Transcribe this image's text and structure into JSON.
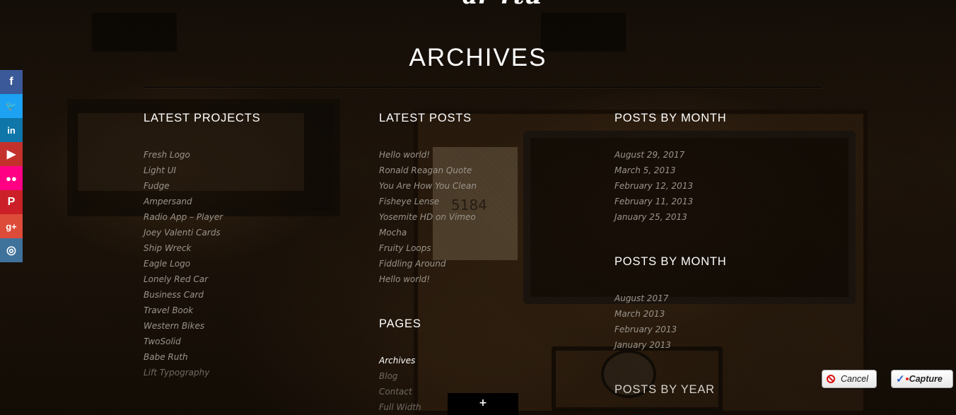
{
  "header": {
    "top_script": "ar-rtu",
    "page_title": "ARCHIVES"
  },
  "background": {
    "card_number": "5184"
  },
  "social": [
    {
      "icon": "facebook-icon",
      "glyph": "f",
      "color": "#3b5998"
    },
    {
      "icon": "twitter-icon",
      "glyph": "🐦",
      "color": "#1da1f2"
    },
    {
      "icon": "linkedin-icon",
      "glyph": "in",
      "color": "#0e76a8"
    },
    {
      "icon": "youtube-icon",
      "glyph": "▶",
      "color": "#c4302b"
    },
    {
      "icon": "flickr-icon",
      "glyph": "●●",
      "color": "#ff0084"
    },
    {
      "icon": "pinterest-icon",
      "glyph": "P",
      "color": "#cb2027"
    },
    {
      "icon": "google-plus-icon",
      "glyph": "g+",
      "color": "#dd4b39"
    },
    {
      "icon": "instagram-icon",
      "glyph": "◎",
      "color": "#3f729b"
    }
  ],
  "latest_projects": {
    "heading": "LATEST PROJECTS",
    "items": [
      "Fresh Logo",
      "Light UI",
      "Fudge",
      "Ampersand",
      "Radio App – Player",
      "Joey Valenti Cards",
      "Ship Wreck",
      "Eagle Logo",
      "Lonely Red Car",
      "Business Card",
      "Travel Book",
      "Western Bikes",
      "TwoSolid",
      "Babe Ruth",
      "Lift Typography"
    ]
  },
  "latest_posts": {
    "heading": "LATEST POSTS",
    "items": [
      "Hello world!",
      "Ronald Reagan Quote",
      "You Are How You Clean",
      "Fisheye Lense",
      "Yosemite HD on Vimeo",
      "Mocha",
      "Fruity Loops",
      "Fiddling Around",
      "Hello world!"
    ]
  },
  "pages": {
    "heading": "PAGES",
    "items": [
      "Archives",
      "Blog",
      "Contact",
      "Full Width"
    ]
  },
  "posts_by_month_daily": {
    "heading": "POSTS BY MONTH",
    "items": [
      "August 29, 2017",
      "March 5, 2013",
      "February 12, 2013",
      "February 11, 2013",
      "January 25, 2013"
    ]
  },
  "posts_by_month": {
    "heading": "POSTS BY MONTH",
    "items": [
      "August 2017",
      "March 2013",
      "February 2013",
      "January 2013"
    ]
  },
  "posts_by_year": {
    "heading": "POSTS BY YEAR"
  },
  "scroll_button": {
    "label": "+"
  },
  "capture_toolbar": {
    "cancel_label": "Cancel",
    "capture_label": "Capture"
  }
}
